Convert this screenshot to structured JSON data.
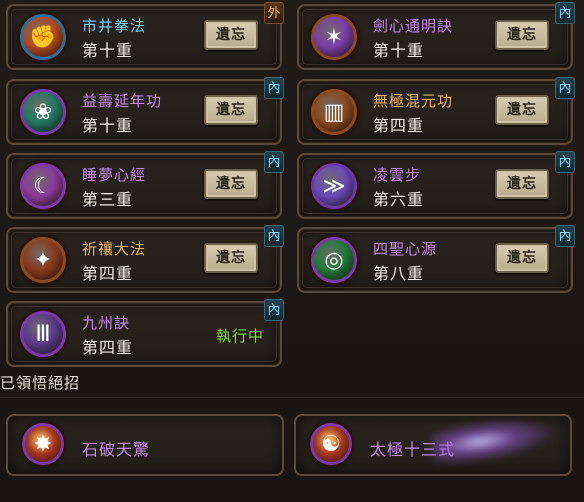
{
  "forget_label": "遺忘",
  "skills": [
    {
      "name": "市井拳法",
      "level": "第十重",
      "badge": "外",
      "badge_type": "out",
      "name_color": "#7fd3f2",
      "icon": "fist-icon",
      "icon_glyph": "✊",
      "icon_bg": "#b24a22",
      "ring": "#2d6f9a",
      "status": ""
    },
    {
      "name": "劍心通明訣",
      "level": "第十重",
      "badge": "內",
      "badge_type": "in",
      "name_color": "#c48ae8",
      "icon": "claw-icon",
      "icon_glyph": "✶",
      "icon_bg": "#7a3ea8",
      "ring": "#8a4a22",
      "status": ""
    },
    {
      "name": "益壽延年功",
      "level": "第十重",
      "badge": "內",
      "badge_type": "in",
      "name_color": "#c48ae8",
      "icon": "lotus-icon",
      "icon_glyph": "❀",
      "icon_bg": "#1f7a63",
      "ring": "#7a3aa8",
      "status": ""
    },
    {
      "name": "無極混元功",
      "level": "第四重",
      "badge": "內",
      "badge_type": "in",
      "name_color": "#e8b66a",
      "icon": "pillar-icon",
      "icon_glyph": "▥",
      "icon_bg": "#8a4a1e",
      "ring": "#8a4a22",
      "status": ""
    },
    {
      "name": "睡夢心經",
      "level": "第三重",
      "badge": "內",
      "badge_type": "in",
      "name_color": "#c48ae8",
      "icon": "moon-icon",
      "icon_glyph": "☾",
      "icon_bg": "#8a3a9a",
      "ring": "#7a3aa8",
      "status": ""
    },
    {
      "name": "凌雲步",
      "level": "第六重",
      "badge": "內",
      "badge_type": "in",
      "name_color": "#c48ae8",
      "icon": "wind-icon",
      "icon_glyph": "≫",
      "icon_bg": "#6a4ab8",
      "ring": "#6a3aa8",
      "status": ""
    },
    {
      "name": "祈禳大法",
      "level": "第四重",
      "badge": "內",
      "badge_type": "in",
      "name_color": "#e8b66a",
      "icon": "star-icon",
      "icon_glyph": "✦",
      "icon_bg": "#8a3a1e",
      "ring": "#8a4a22",
      "status": ""
    },
    {
      "name": "四聖心源",
      "level": "第八重",
      "badge": "內",
      "badge_type": "in",
      "name_color": "#c48ae8",
      "icon": "swirl-icon",
      "icon_glyph": "◎",
      "icon_bg": "#1f7a3a",
      "ring": "#7a3aa8",
      "status": ""
    },
    {
      "name": "九州訣",
      "level": "第四重",
      "badge": "內",
      "badge_type": "in",
      "name_color": "#c48ae8",
      "icon": "gate-icon",
      "icon_glyph": "Ⅲ",
      "icon_bg": "#5a3a8a",
      "ring": "#7a3aa8",
      "status": "執行中"
    }
  ],
  "section_title": "已領悟絕招",
  "moves": [
    {
      "name": "石破天驚",
      "name_color": "#c48ae8",
      "icon": "burst-icon",
      "icon_glyph": "✸",
      "icon_bg": "#a8381e"
    },
    {
      "name": "太極十三式",
      "name_color": "#c48ae8",
      "icon": "taiji-icon",
      "icon_glyph": "☯",
      "icon_bg": "#a8381e"
    }
  ]
}
